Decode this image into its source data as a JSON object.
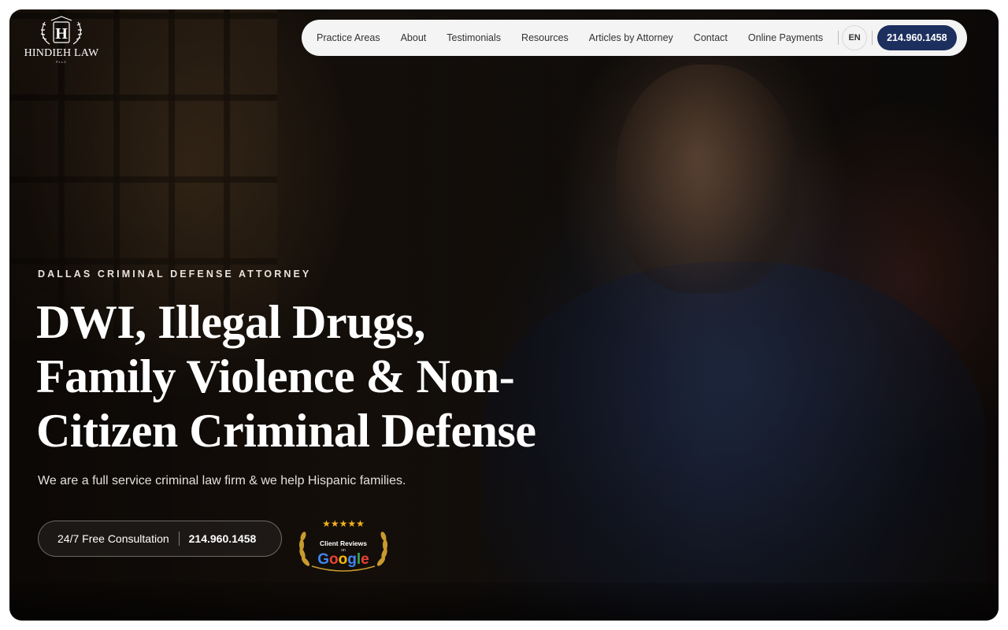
{
  "brand": {
    "name": "HINDIEH LAW",
    "sub": "PLLC",
    "monogram": "H",
    "icon": "crest-logo-icon"
  },
  "nav": {
    "links": [
      "Practice Areas",
      "About",
      "Testimonials",
      "Resources",
      "Articles by Attorney",
      "Contact",
      "Online Payments"
    ],
    "language": "EN",
    "phone": "214.960.1458",
    "phone_color": "#1c2f5e"
  },
  "hero": {
    "eyebrow": "DALLAS CRIMINAL DEFENSE ATTORNEY",
    "headline_lines": [
      "DWI, Illegal Drugs,",
      "Family Violence & Non-",
      "Citizen Criminal Defense"
    ],
    "subtext": "We are a full service criminal law firm & we help Hispanic families."
  },
  "cta": {
    "label": "24/7 Free Consultation",
    "phone": "214.960.1458"
  },
  "badge": {
    "stars": "★★★★★",
    "rating_stars": 5,
    "title": "Client Reviews",
    "on": "on",
    "google_letters": [
      {
        "ch": "G",
        "color": "#4285f4"
      },
      {
        "ch": "o",
        "color": "#ea4335"
      },
      {
        "ch": "o",
        "color": "#fbbc05"
      },
      {
        "ch": "g",
        "color": "#4285f4"
      },
      {
        "ch": "l",
        "color": "#34a853"
      },
      {
        "ch": "e",
        "color": "#ea4335"
      }
    ],
    "icon": "laurel-wreath-icon"
  }
}
